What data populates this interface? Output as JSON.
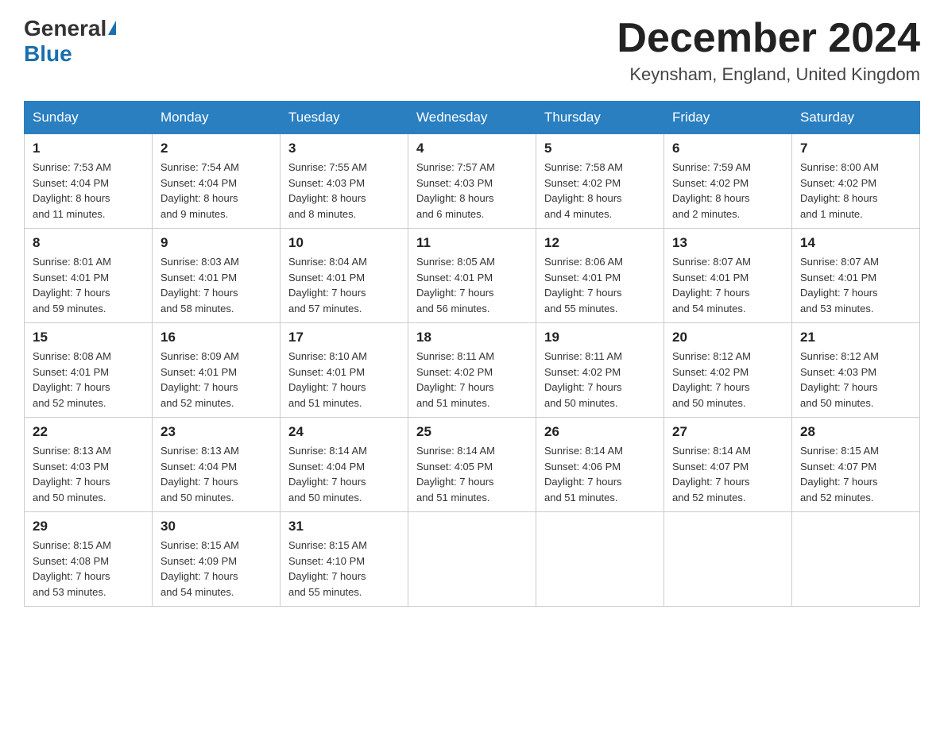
{
  "header": {
    "logo": {
      "general": "General",
      "triangle": "▶",
      "blue": "Blue"
    },
    "title": "December 2024",
    "location": "Keynsham, England, United Kingdom"
  },
  "days_of_week": [
    "Sunday",
    "Monday",
    "Tuesday",
    "Wednesday",
    "Thursday",
    "Friday",
    "Saturday"
  ],
  "weeks": [
    [
      {
        "day": "1",
        "sunrise": "7:53 AM",
        "sunset": "4:04 PM",
        "daylight": "8 hours and 11 minutes."
      },
      {
        "day": "2",
        "sunrise": "7:54 AM",
        "sunset": "4:04 PM",
        "daylight": "8 hours and 9 minutes."
      },
      {
        "day": "3",
        "sunrise": "7:55 AM",
        "sunset": "4:03 PM",
        "daylight": "8 hours and 8 minutes."
      },
      {
        "day": "4",
        "sunrise": "7:57 AM",
        "sunset": "4:03 PM",
        "daylight": "8 hours and 6 minutes."
      },
      {
        "day": "5",
        "sunrise": "7:58 AM",
        "sunset": "4:02 PM",
        "daylight": "8 hours and 4 minutes."
      },
      {
        "day": "6",
        "sunrise": "7:59 AM",
        "sunset": "4:02 PM",
        "daylight": "8 hours and 2 minutes."
      },
      {
        "day": "7",
        "sunrise": "8:00 AM",
        "sunset": "4:02 PM",
        "daylight": "8 hours and 1 minute."
      }
    ],
    [
      {
        "day": "8",
        "sunrise": "8:01 AM",
        "sunset": "4:01 PM",
        "daylight": "7 hours and 59 minutes."
      },
      {
        "day": "9",
        "sunrise": "8:03 AM",
        "sunset": "4:01 PM",
        "daylight": "7 hours and 58 minutes."
      },
      {
        "day": "10",
        "sunrise": "8:04 AM",
        "sunset": "4:01 PM",
        "daylight": "7 hours and 57 minutes."
      },
      {
        "day": "11",
        "sunrise": "8:05 AM",
        "sunset": "4:01 PM",
        "daylight": "7 hours and 56 minutes."
      },
      {
        "day": "12",
        "sunrise": "8:06 AM",
        "sunset": "4:01 PM",
        "daylight": "7 hours and 55 minutes."
      },
      {
        "day": "13",
        "sunrise": "8:07 AM",
        "sunset": "4:01 PM",
        "daylight": "7 hours and 54 minutes."
      },
      {
        "day": "14",
        "sunrise": "8:07 AM",
        "sunset": "4:01 PM",
        "daylight": "7 hours and 53 minutes."
      }
    ],
    [
      {
        "day": "15",
        "sunrise": "8:08 AM",
        "sunset": "4:01 PM",
        "daylight": "7 hours and 52 minutes."
      },
      {
        "day": "16",
        "sunrise": "8:09 AM",
        "sunset": "4:01 PM",
        "daylight": "7 hours and 52 minutes."
      },
      {
        "day": "17",
        "sunrise": "8:10 AM",
        "sunset": "4:01 PM",
        "daylight": "7 hours and 51 minutes."
      },
      {
        "day": "18",
        "sunrise": "8:11 AM",
        "sunset": "4:02 PM",
        "daylight": "7 hours and 51 minutes."
      },
      {
        "day": "19",
        "sunrise": "8:11 AM",
        "sunset": "4:02 PM",
        "daylight": "7 hours and 50 minutes."
      },
      {
        "day": "20",
        "sunrise": "8:12 AM",
        "sunset": "4:02 PM",
        "daylight": "7 hours and 50 minutes."
      },
      {
        "day": "21",
        "sunrise": "8:12 AM",
        "sunset": "4:03 PM",
        "daylight": "7 hours and 50 minutes."
      }
    ],
    [
      {
        "day": "22",
        "sunrise": "8:13 AM",
        "sunset": "4:03 PM",
        "daylight": "7 hours and 50 minutes."
      },
      {
        "day": "23",
        "sunrise": "8:13 AM",
        "sunset": "4:04 PM",
        "daylight": "7 hours and 50 minutes."
      },
      {
        "day": "24",
        "sunrise": "8:14 AM",
        "sunset": "4:04 PM",
        "daylight": "7 hours and 50 minutes."
      },
      {
        "day": "25",
        "sunrise": "8:14 AM",
        "sunset": "4:05 PM",
        "daylight": "7 hours and 51 minutes."
      },
      {
        "day": "26",
        "sunrise": "8:14 AM",
        "sunset": "4:06 PM",
        "daylight": "7 hours and 51 minutes."
      },
      {
        "day": "27",
        "sunrise": "8:14 AM",
        "sunset": "4:07 PM",
        "daylight": "7 hours and 52 minutes."
      },
      {
        "day": "28",
        "sunrise": "8:15 AM",
        "sunset": "4:07 PM",
        "daylight": "7 hours and 52 minutes."
      }
    ],
    [
      {
        "day": "29",
        "sunrise": "8:15 AM",
        "sunset": "4:08 PM",
        "daylight": "7 hours and 53 minutes."
      },
      {
        "day": "30",
        "sunrise": "8:15 AM",
        "sunset": "4:09 PM",
        "daylight": "7 hours and 54 minutes."
      },
      {
        "day": "31",
        "sunrise": "8:15 AM",
        "sunset": "4:10 PM",
        "daylight": "7 hours and 55 minutes."
      },
      null,
      null,
      null,
      null
    ]
  ],
  "labels": {
    "sunrise": "Sunrise:",
    "sunset": "Sunset:",
    "daylight": "Daylight:"
  }
}
